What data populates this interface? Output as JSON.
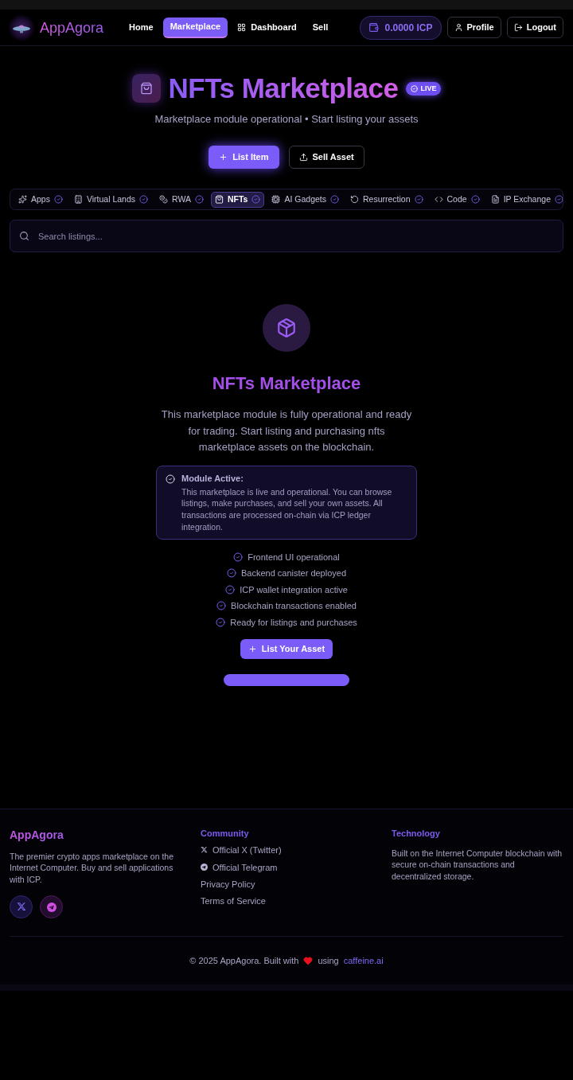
{
  "header": {
    "logo": "AppAgora",
    "nav": [
      {
        "label": "Home",
        "selected": false
      },
      {
        "label": "Marketplace",
        "selected": true
      },
      {
        "label": "Dashboard",
        "selected": false
      },
      {
        "label": "Sell",
        "selected": false
      }
    ],
    "wallet_balance": "0.0000 ICP",
    "profile": "Profile",
    "logout": "Logout"
  },
  "hero": {
    "title": "NFTs Marketplace",
    "badge": "LIVE",
    "subtitle": "Marketplace module operational • Start listing your assets",
    "actions": [
      {
        "label": "List Item",
        "kind": "primary"
      },
      {
        "label": "Sell Asset",
        "kind": "outline"
      }
    ]
  },
  "categories": [
    {
      "label": "Apps",
      "selected": false
    },
    {
      "label": "Virtual Lands",
      "selected": false
    },
    {
      "label": "RWA",
      "selected": false
    },
    {
      "label": "NFTs",
      "selected": true
    },
    {
      "label": "AI Gadgets",
      "selected": false
    },
    {
      "label": "Resurrection",
      "selected": false
    },
    {
      "label": "Code",
      "selected": false
    },
    {
      "label": "IP Exchange",
      "selected": false
    }
  ],
  "search": {
    "placeholder": "Search listings..."
  },
  "module": {
    "title": "NFTs Marketplace",
    "description": "This marketplace module is fully operational and ready for trading. Start listing and purchasing nfts marketplace assets on the blockchain.",
    "notice": {
      "title": "Module Active:",
      "text": "This marketplace is live and operational. You can browse listings, make purchases, and sell your own assets. All transactions are processed on-chain via ICP ledger integration."
    },
    "features": [
      "Frontend UI operational",
      "Backend canister deployed",
      "ICP wallet integration active",
      "Blockchain transactions enabled",
      "Ready for listings and purchases"
    ],
    "button": "List Your Asset"
  },
  "footer": {
    "brand": {
      "name": "AppAgora",
      "text": "The premier crypto apps marketplace on the Internet Computer. Buy and sell applications with ICP."
    },
    "community": {
      "heading": "Community",
      "links": [
        {
          "label": "Official X (Twitter)",
          "kind": "x"
        },
        {
          "label": "Official Telegram",
          "kind": "telegram"
        },
        {
          "label": "Privacy Policy",
          "kind": "page"
        },
        {
          "label": "Terms of Service",
          "kind": "page"
        }
      ]
    },
    "technology": {
      "heading": "Technology",
      "text": "Built on the Internet Computer blockchain with secure on-chain transactions and decentralized storage."
    },
    "copyright": {
      "text": "© 2025 AppAgora. Built with",
      "connector": "using",
      "link": "caffeine.ai"
    }
  }
}
